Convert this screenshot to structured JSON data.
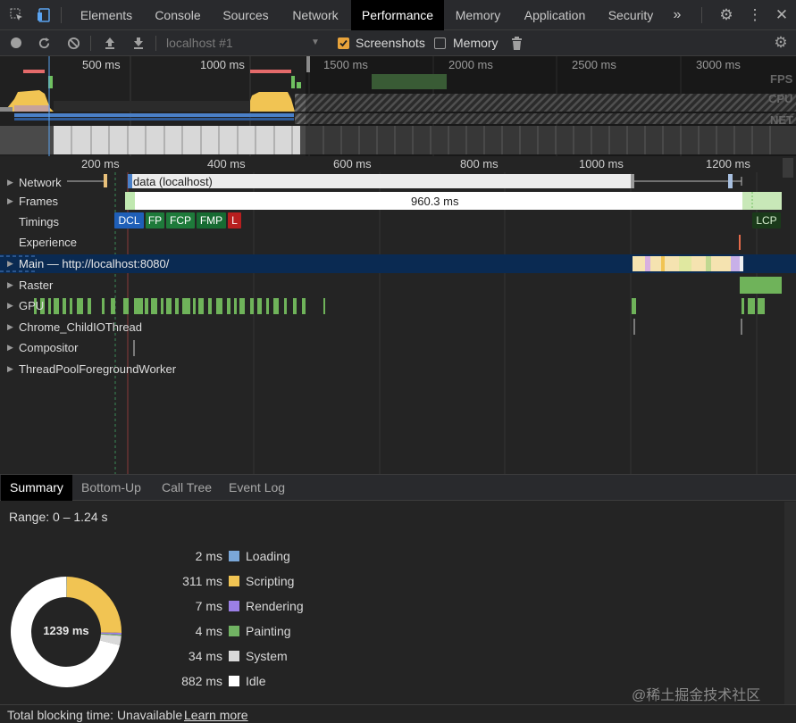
{
  "tabs": {
    "elements": "Elements",
    "console": "Console",
    "sources": "Sources",
    "network": "Network",
    "performance": "Performance",
    "memory": "Memory",
    "application": "Application",
    "security": "Security",
    "more": "»"
  },
  "toolbar": {
    "profile_select": "localhost #1",
    "screenshots_label": "Screenshots",
    "screenshots_checked": true,
    "memory_label": "Memory",
    "memory_checked": false
  },
  "overview": {
    "ticks": [
      "500 ms",
      "1000 ms",
      "1500 ms",
      "2000 ms",
      "2500 ms",
      "3000 ms"
    ],
    "lanes": [
      "FPS",
      "CPU",
      "NET"
    ]
  },
  "timeline": {
    "ticks": [
      "200 ms",
      "400 ms",
      "600 ms",
      "800 ms",
      "1000 ms",
      "1200 ms"
    ],
    "network_label": "Network",
    "network_request": "data (localhost)",
    "frames_label": "Frames",
    "frame_duration": "960.3 ms",
    "timings_label": "Timings",
    "timings_badges": [
      "DCL",
      "FP",
      "FCP",
      "FMP",
      "L"
    ],
    "lcp_badge": "LCP",
    "experience_label": "Experience",
    "main_label": "Main — http://localhost:8080/",
    "raster_label": "Raster",
    "gpu_label": "GPU",
    "childio_label": "Chrome_ChildIOThread",
    "compositor_label": "Compositor",
    "threadpool_label": "ThreadPoolForegroundWorker"
  },
  "bottom_tabs": {
    "summary": "Summary",
    "bottom_up": "Bottom-Up",
    "call_tree": "Call Tree",
    "event_log": "Event Log"
  },
  "summary": {
    "range": "Range: 0 – 1.24 s",
    "total": "1239 ms",
    "items": [
      {
        "value": "2 ms",
        "label": "Loading",
        "ms": 2,
        "color": "#7aa7d8"
      },
      {
        "value": "311 ms",
        "label": "Scripting",
        "ms": 311,
        "color": "#f1c453"
      },
      {
        "value": "7 ms",
        "label": "Rendering",
        "ms": 7,
        "color": "#9b7fe6"
      },
      {
        "value": "4 ms",
        "label": "Painting",
        "ms": 4,
        "color": "#71b363"
      },
      {
        "value": "34 ms",
        "label": "System",
        "ms": 34,
        "color": "#d9d9d9"
      },
      {
        "value": "882 ms",
        "label": "Idle",
        "ms": 882,
        "color": "#ffffff"
      }
    ]
  },
  "status": {
    "tbt": "Total blocking time: Unavailable",
    "learn_more": "Learn more",
    "watermark": "@稀土掘金技术社区"
  },
  "colors": {
    "accent": "#8ab4f8",
    "selected_row": "#0a2a52",
    "active_tab": "#000000"
  }
}
